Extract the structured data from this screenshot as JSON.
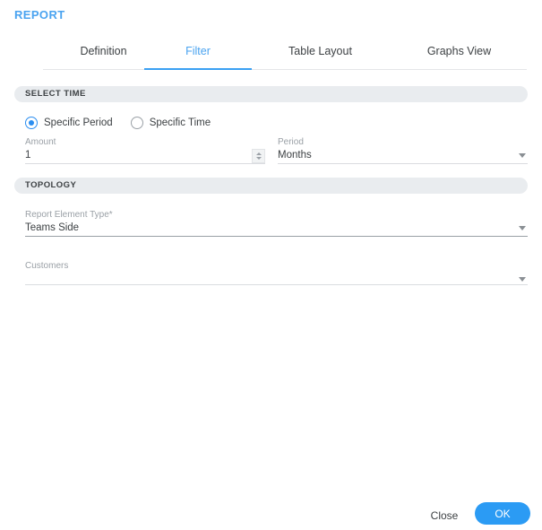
{
  "header": {
    "title": "REPORT",
    "title_color": "#4aa3f0"
  },
  "tabs": {
    "active_index": 1,
    "items": [
      {
        "label": "Definition"
      },
      {
        "label": "Filter"
      },
      {
        "label": "Table Layout"
      },
      {
        "label": "Graphs View"
      }
    ],
    "active_color": "#3aa0f3"
  },
  "sections": {
    "select_time": {
      "header": "SELECT TIME",
      "radios": [
        {
          "label": "Specific Period",
          "checked": true
        },
        {
          "label": "Specific Time",
          "checked": false
        }
      ],
      "amount": {
        "label": "Amount",
        "value": "1",
        "placeholder": ""
      },
      "period": {
        "label": "Period",
        "value": "Months"
      }
    },
    "topology": {
      "header": "TOPOLOGY",
      "report_element_type": {
        "label": "Report Element Type*",
        "value": "Teams Side"
      },
      "customers": {
        "label": "Customers",
        "value": ""
      }
    }
  },
  "footer": {
    "close_label": "Close",
    "ok_label": "OK",
    "ok_color": "#2b9bf4"
  },
  "icons": {
    "spinner": "number-spinner-icon",
    "dropdown": "chevron-down-icon"
  }
}
